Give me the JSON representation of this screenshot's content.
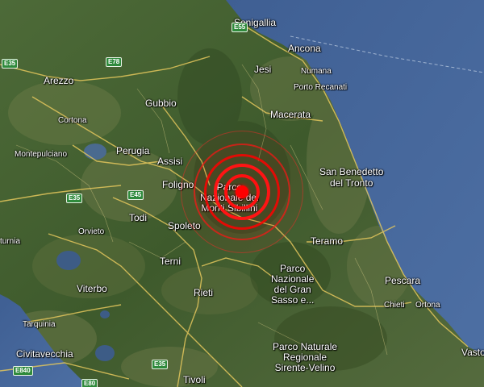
{
  "map": {
    "type": "satellite-hybrid",
    "colors": {
      "sea": "#4a6a9a",
      "land": "#4a6636",
      "roads": "#e6c65a",
      "epicenter": "#ff1a1a"
    }
  },
  "places": {
    "senigallia": "Senigallia",
    "ancona": "Ancona",
    "numana": "Numana",
    "jesi": "Jesi",
    "porto_recanati": "Porto Recanati",
    "arezzo": "Arezzo",
    "gubbio": "Gubbio",
    "macerata": "Macerata",
    "cortona": "Cortona",
    "perugia": "Perugia",
    "montepulciano": "Montepulciano",
    "assisi": "Assisi",
    "san_benedetto": "San Benedetto",
    "del_tronto": "del Tronto",
    "foligno": "Foligno",
    "todi": "Todi",
    "spoleto": "Spoleto",
    "orvieto": "Orvieto",
    "teramo": "Teramo",
    "turnia": "turnia",
    "terni": "Terni",
    "pescara": "Pescara",
    "viterbo": "Viterbo",
    "rieti": "Rieti",
    "chieti": "Chieti",
    "ortona": "Ortona",
    "tarquinia": "Tarquinia",
    "civitavecchia": "Civitavecchia",
    "vasto": "Vasto",
    "tivoli": "Tivoli"
  },
  "parks": {
    "sibillini": [
      "Parco",
      "Nazionale dei",
      "Monti Sibillini"
    ],
    "gran_sasso": [
      "Parco",
      "Nazionale",
      "del Gran",
      "Sasso e..."
    ],
    "sirente": [
      "Parco Naturale",
      "Regionale",
      "Sirente-Velino"
    ]
  },
  "roads": {
    "e55": "E55",
    "e35_nw": "E35",
    "e78": "E78",
    "e35_w": "E35",
    "e45": "E45",
    "e840": "E840",
    "e80": "E80",
    "e35_s": "E35"
  },
  "epicenter": {
    "rings": 5
  }
}
